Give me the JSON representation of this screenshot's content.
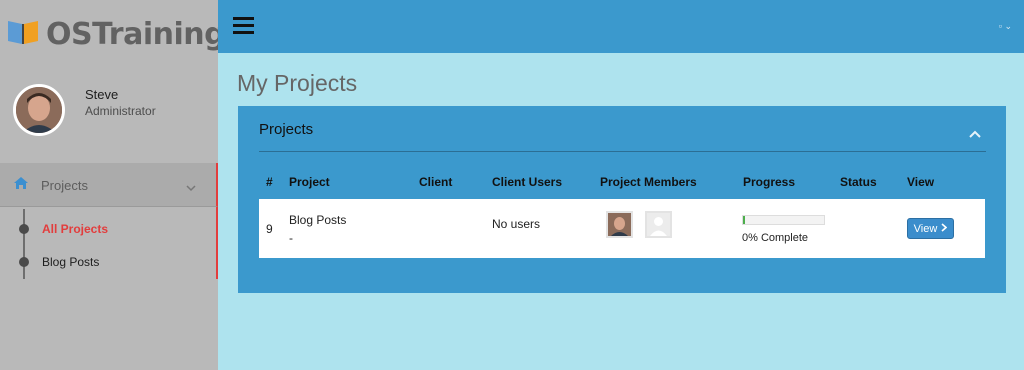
{
  "brand": {
    "name": "OSTraining"
  },
  "user": {
    "name": "Steve",
    "role": "Administrator"
  },
  "sidebar": {
    "section_label": "Projects",
    "items": [
      {
        "label": "All Projects",
        "active": true
      },
      {
        "label": "Blog Posts",
        "active": false
      }
    ]
  },
  "page": {
    "title": "My Projects"
  },
  "panel": {
    "title": "Projects",
    "columns": [
      "#",
      "Project",
      "Client",
      "Client Users",
      "Project Members",
      "Progress",
      "Status",
      "View"
    ],
    "rows": [
      {
        "id": "9",
        "project": "Blog Posts",
        "project_sub": "-",
        "client": "",
        "client_users": "No users",
        "progress_fraction": 0.0,
        "progress_label": "0% Complete",
        "status": "",
        "view_label": "View"
      }
    ]
  },
  "colors": {
    "accent": "#3b99cd",
    "active": "#e23d3d",
    "progress": "#4cae4c"
  },
  "icons": [
    "logo-book-icon",
    "home-icon",
    "chevron-down-icon",
    "hamburger-icon",
    "chevron-up-icon",
    "chevron-right-icon",
    "user-placeholder-icon"
  ]
}
